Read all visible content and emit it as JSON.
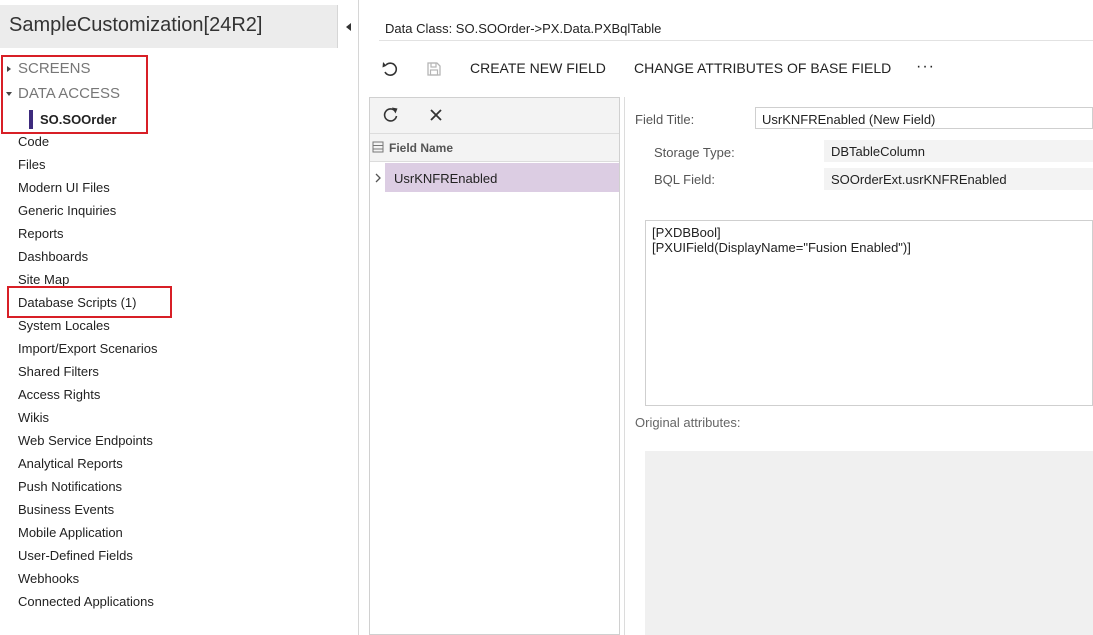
{
  "project": {
    "title": "SampleCustomization[24R2]"
  },
  "tree": {
    "screens_label": "SCREENS",
    "data_access_label": "DATA ACCESS",
    "data_access_child": "SO.SOOrder",
    "items": [
      "Code",
      "Files",
      "Modern UI Files",
      "Generic Inquiries",
      "Reports",
      "Dashboards",
      "Site Map",
      "Database Scripts (1)",
      "System Locales",
      "Import/Export Scenarios",
      "Shared Filters",
      "Access Rights",
      "Wikis",
      "Web Service Endpoints",
      "Analytical Reports",
      "Push Notifications",
      "Business Events",
      "Mobile Application",
      "User-Defined Fields",
      "Webhooks",
      "Connected Applications"
    ]
  },
  "header": {
    "data_class": "Data Class: SO.SOOrder->PX.Data.PXBqlTable"
  },
  "toolbar": {
    "create_new_field": "CREATE NEW FIELD",
    "change_attributes": "CHANGE ATTRIBUTES OF BASE FIELD",
    "more": "···"
  },
  "grid": {
    "column_header": "Field Name",
    "rows": [
      "UsrKNFREnabled"
    ]
  },
  "form": {
    "field_title_label": "Field Title:",
    "field_title_value": "UsrKNFREnabled (New Field)",
    "storage_type_label": "Storage Type:",
    "storage_type_value": "DBTableColumn",
    "bql_field_label": "BQL Field:",
    "bql_field_value": "SOOrderExt.usrKNFREnabled",
    "attributes": "[PXDBBool]\n[PXUIField(DisplayName=\"Fusion Enabled\")]",
    "original_attributes_label": "Original attributes:"
  },
  "colors": {
    "selected_row": "#dccde3",
    "active_marker": "#3d2a7d",
    "highlight_box": "#d81f26"
  }
}
